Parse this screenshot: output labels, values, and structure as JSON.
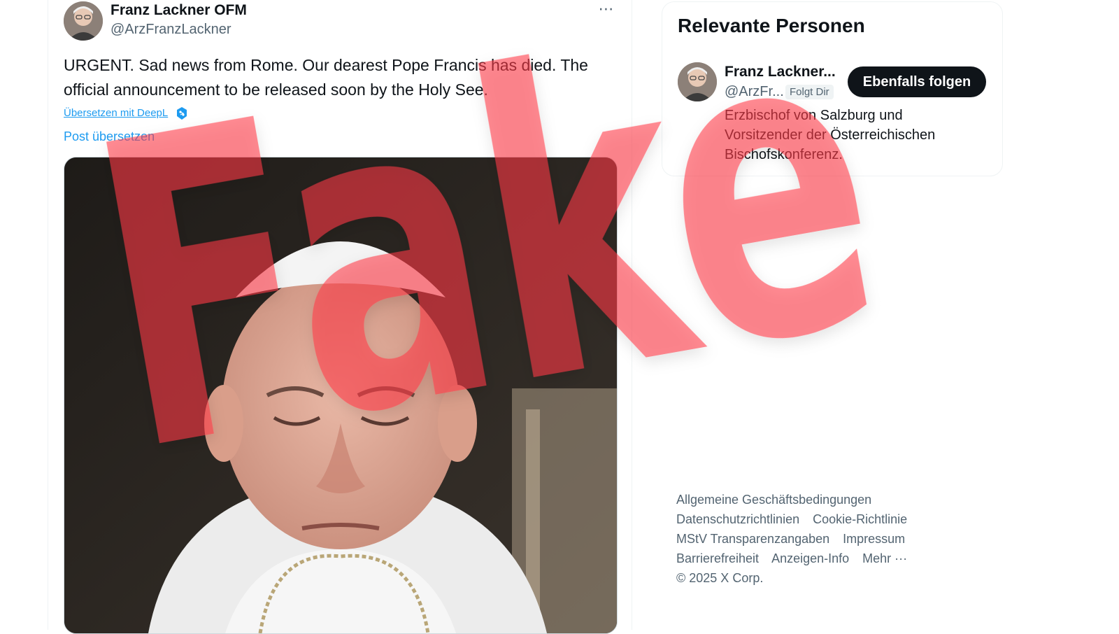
{
  "post": {
    "author_name": "Franz Lackner OFM",
    "author_handle": "@ArzFranzLackner",
    "more_icon": "more-horizontal-icon",
    "text": "URGENT. Sad news from Rome. Our dearest Pope Francis has died. The official announcement to be released soon by the Holy See.",
    "translate_deepl": "Übersetzen mit DeepL",
    "translate_post": "Post übersetzen",
    "media": "photo"
  },
  "sidebar": {
    "relevant": {
      "title": "Relevante Personen",
      "person": {
        "name": "Franz Lackner...",
        "handle": "@ArzFr...",
        "follows_you": "Folgt Dir",
        "follow_button": "Ebenfalls folgen",
        "bio": "Erzbischof von Salzburg und Vorsitzender der Österreichischen Bischofskonferenz."
      }
    },
    "footer": {
      "links": [
        "Allgemeine Geschäftsbedingungen",
        "Datenschutzrichtlinien",
        "Cookie-Richtlinie",
        "MStV Transparenzangaben",
        "Impressum",
        "Barrierefreiheit",
        "Anzeigen-Info",
        "Mehr ···"
      ],
      "copyright": "© 2025 X Corp."
    }
  },
  "overlay": {
    "stamp_text": "Fake",
    "stamp_color": "#ff3b46"
  },
  "colors": {
    "link": "#1d9bf0",
    "secondary_text": "#536471",
    "primary_text": "#0f1419",
    "button_bg": "#0f1419"
  }
}
